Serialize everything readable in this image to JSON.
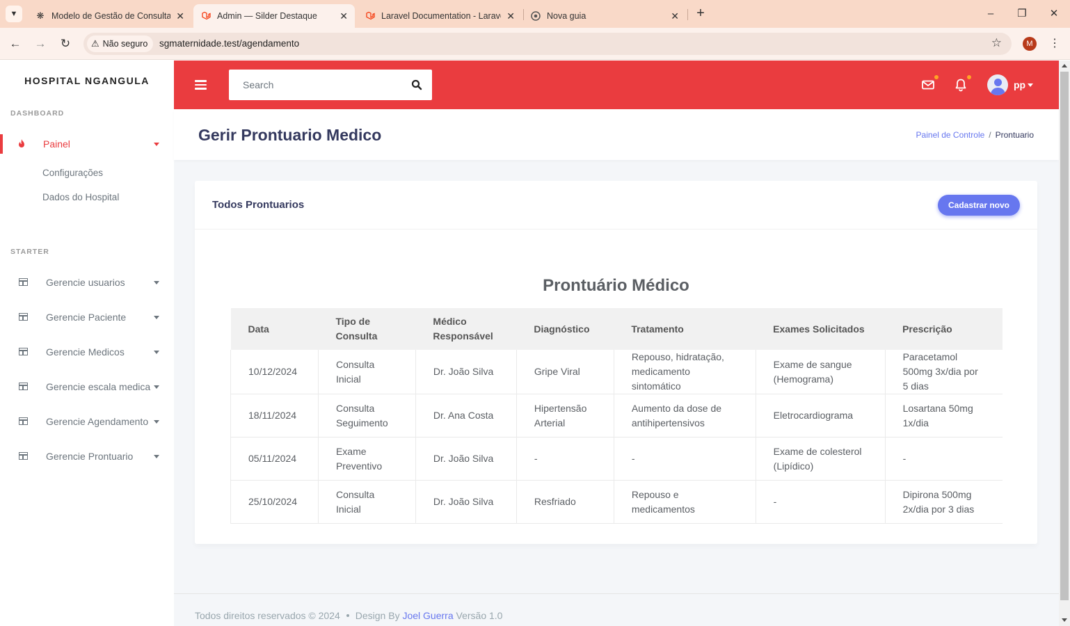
{
  "browser": {
    "tabs": [
      {
        "title": "Modelo de Gestão de Consulta",
        "icon": "openai-icon",
        "active": false
      },
      {
        "title": "Admin — Silder Destaque",
        "icon": "laravel-icon",
        "active": true
      },
      {
        "title": "Laravel Documentation - Larave",
        "icon": "laravel-icon",
        "active": false
      },
      {
        "title": "Nova guia",
        "icon": "chrome-icon",
        "active": false
      }
    ],
    "security_label": "Não seguro",
    "url": "sgmaternidade.test/agendamento",
    "profile_initial": "M"
  },
  "sidebar": {
    "brand": "HOSPITAL NGANGULA",
    "sections": [
      {
        "title": "DASHBOARD"
      },
      {
        "title": "STARTER"
      }
    ],
    "active_item": {
      "label": "Painel",
      "icon": "fire-icon"
    },
    "sub_items": [
      "Configurações",
      "Dados do Hospital"
    ],
    "items": [
      {
        "label": "Gerencie usuarios",
        "icon": "columns-icon"
      },
      {
        "label": "Gerencie Paciente",
        "icon": "columns-icon"
      },
      {
        "label": "Gerencie Medicos",
        "icon": "columns-icon"
      },
      {
        "label": "Gerencie escala medica",
        "icon": "columns-icon"
      },
      {
        "label": "Gerencie Agendamento",
        "icon": "columns-icon"
      },
      {
        "label": "Gerencie Prontuario",
        "icon": "columns-icon"
      }
    ]
  },
  "topbar": {
    "search_placeholder": "Search",
    "user_name": "pp",
    "accent_color": "#ea3c3f"
  },
  "header": {
    "title": "Gerir Prontuario Medico",
    "breadcrumb": [
      "Painel de Controle",
      "Prontuario"
    ]
  },
  "card": {
    "title": "Todos Prontuarios",
    "button_label": "Cadastrar novo",
    "table_title": "Prontuário Médico",
    "columns": [
      "Data",
      "Tipo de Consulta",
      "Médico Responsável",
      "Diagnóstico",
      "Tratamento",
      "Exames Solicitados",
      "Prescrição"
    ],
    "rows": [
      [
        "10/12/2024",
        "Consulta Inicial",
        "Dr. João Silva",
        "Gripe Viral",
        "Repouso, hidratação, medicamento sintomático",
        "Exame de sangue (Hemograma)",
        "Paracetamol 500mg 3x/dia por 5 dias"
      ],
      [
        "18/11/2024",
        "Consulta Seguimento",
        "Dr. Ana Costa",
        "Hipertensão Arterial",
        "Aumento da dose de antihipertensivos",
        "Eletrocardiograma",
        "Losartana 50mg 1x/dia"
      ],
      [
        "05/11/2024",
        "Exame Preventivo",
        "Dr. João Silva",
        "-",
        "-",
        "Exame de colesterol (Lipídico)",
        "-"
      ],
      [
        "25/10/2024",
        "Consulta Inicial",
        "Dr. João Silva",
        "Resfriado",
        "Repouso e medicamentos",
        "-",
        "Dipirona 500mg 2x/dia por 3 dias"
      ]
    ]
  },
  "footer": {
    "copyright": "Todos direitos reservados © 2024",
    "design_by": "Design By",
    "author": "Joel Guerra",
    "version": "Versão 1.0"
  }
}
